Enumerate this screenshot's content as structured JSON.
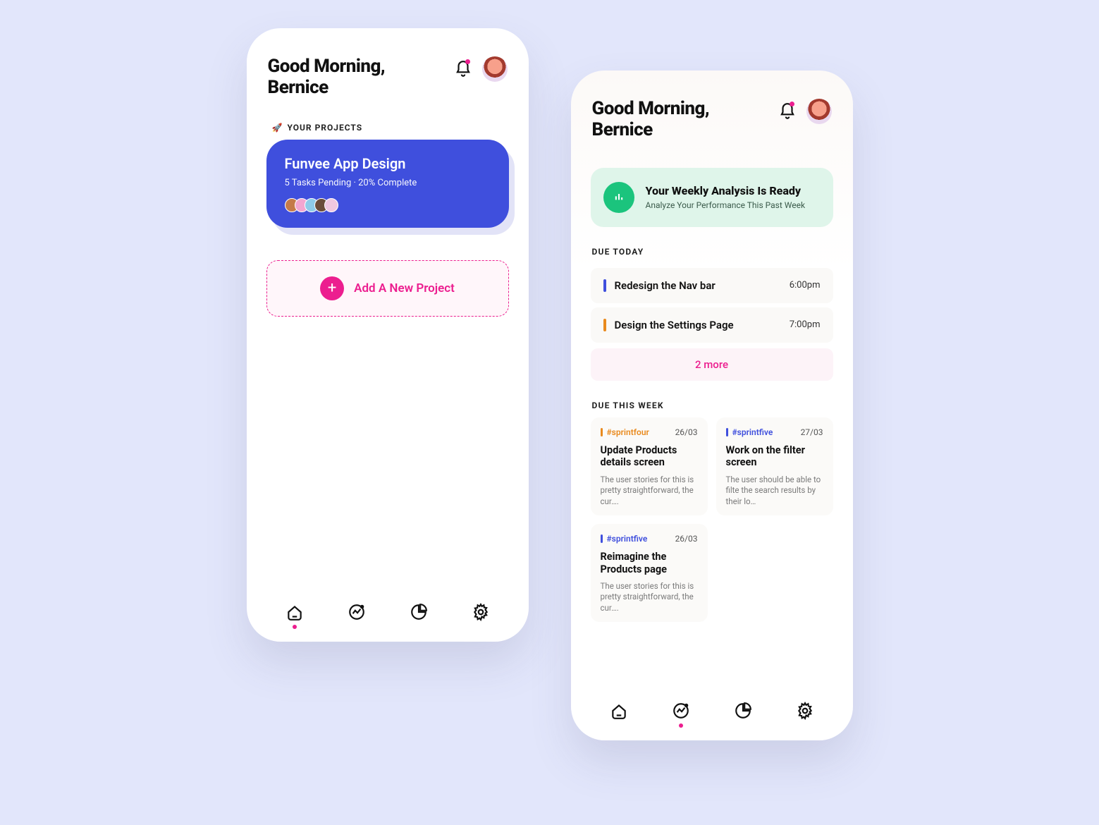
{
  "greeting_line1": "Good Morning,",
  "greeting_line2": "Bernice",
  "projects_section_label": "YOUR PROJECTS",
  "rocket": "🚀",
  "project": {
    "title": "Funvee App Design",
    "meta": "5 Tasks Pending · 20% Complete"
  },
  "add_project_label": "Add A New Project",
  "analysis": {
    "title": "Your Weekly Analysis Is Ready",
    "subtitle": "Analyze Your Performance This Past Week"
  },
  "due_today_label": "DUE TODAY",
  "tasks": [
    {
      "title": "Redesign the Nav bar",
      "time": "6:00pm",
      "color": "blue"
    },
    {
      "title": "Design the Settings Page",
      "time": "7:00pm",
      "color": "orange"
    }
  ],
  "more_label": "2 more",
  "due_week_label": "DUE THIS WEEK",
  "week_cards": [
    {
      "sprint": "#sprintfour",
      "sprint_color": "orange",
      "date": "26/03",
      "title": "Update Products details screen",
      "desc": "The user stories for this is pretty straightforward, the cur…."
    },
    {
      "sprint": "#sprintfive",
      "sprint_color": "blue",
      "date": "27/03",
      "title": "Work on the filter screen",
      "desc": "The user should be able to filte the search results by their lo…"
    },
    {
      "sprint": "#sprintfive",
      "sprint_color": "blue",
      "date": "26/03",
      "title": "Reimagine the Products page",
      "desc": "The user stories for this is pretty straightforward, the cur…."
    }
  ]
}
